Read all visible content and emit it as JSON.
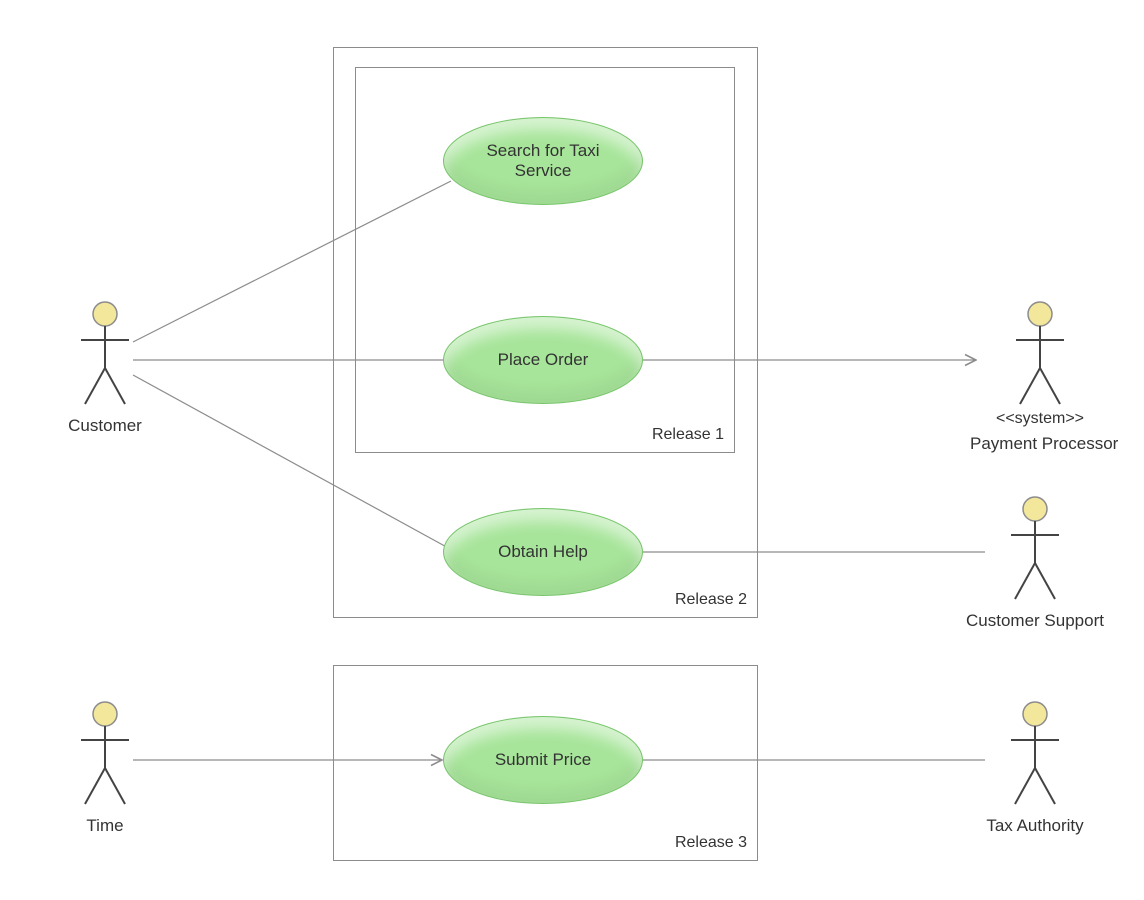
{
  "actors": {
    "customer": {
      "label": "Customer"
    },
    "time": {
      "label": "Time"
    },
    "payment_processor": {
      "stereotype": "<<system>>",
      "label": "Payment Processor"
    },
    "customer_support": {
      "label": "Customer Support"
    },
    "tax_authority": {
      "label": "Tax Authority"
    }
  },
  "use_cases": {
    "search_taxi": {
      "label": "Search for Taxi Service"
    },
    "place_order": {
      "label": "Place Order"
    },
    "obtain_help": {
      "label": "Obtain Help"
    },
    "submit_price": {
      "label": "Submit Price"
    }
  },
  "boundaries": {
    "release1": {
      "label": "Release 1"
    },
    "release2": {
      "label": "Release 2"
    },
    "release3": {
      "label": "Release 3"
    }
  },
  "associations": [
    {
      "from": "customer",
      "to": "search_taxi",
      "arrow": false
    },
    {
      "from": "customer",
      "to": "place_order",
      "arrow": false
    },
    {
      "from": "customer",
      "to": "obtain_help",
      "arrow": false
    },
    {
      "from": "place_order",
      "to": "payment_processor",
      "arrow": true
    },
    {
      "from": "obtain_help",
      "to": "customer_support",
      "arrow": false
    },
    {
      "from": "time",
      "to": "submit_price",
      "arrow": true
    },
    {
      "from": "submit_price",
      "to": "tax_authority",
      "arrow": false
    }
  ],
  "colors": {
    "usecase_fill": "#a7e59a",
    "usecase_border": "#77c56b",
    "actor_head": "#f2e79a",
    "line": "#8c8c8c",
    "box_border": "#8c8c8c"
  }
}
